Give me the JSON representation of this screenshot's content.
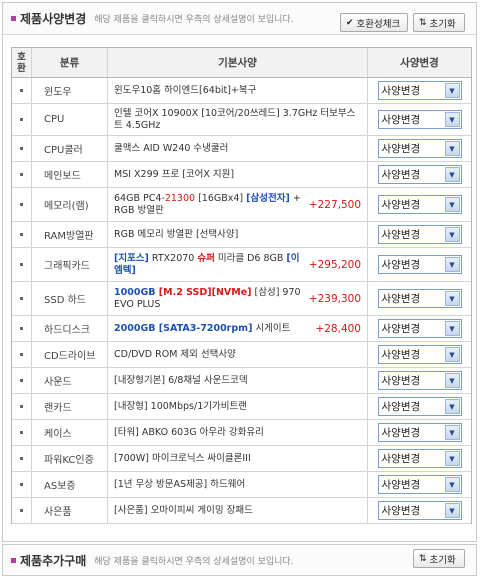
{
  "spec_panel": {
    "title": "제품사양변경",
    "hint": "해당 제품을 클릭하시면 우측의 상세설명이 보입니다.",
    "check_button": "호환성체크",
    "reset_button": "초기화"
  },
  "table": {
    "headers": {
      "no": "호 환",
      "category": "분류",
      "spec": "기본사양",
      "change": "사양변경"
    },
    "select_label": "사양변경",
    "rows": [
      {
        "category": "윈도우",
        "spec": "윈도우10홈 하이엔드[64bit]+복구"
      },
      {
        "category": "CPU",
        "spec": "인텔 코어X 10900X [10코어/20쓰레드] 3.7GHz 터보부스트 4.5GHz"
      },
      {
        "category": "CPU쿨러",
        "spec": "쿨맥스 AID W240 수냉쿨러"
      },
      {
        "category": "메인보드",
        "spec": "MSI X299 프로 [코어X 지원]"
      },
      {
        "category": "메모리(램)",
        "spec_parts": [
          "64GB PC4-",
          "21300",
          " [16GBx4] ",
          "[삼성전자]",
          " + RGB 방열판"
        ],
        "price": "+227,500"
      },
      {
        "category": "RAM방열판",
        "spec": "RGB 메모리 방열판 [선택사양]"
      },
      {
        "category": "그래픽카드",
        "spec_parts": [
          "[지포스]",
          " RTX2070 ",
          "슈퍼",
          " 미라클 D6 8GB ",
          "[이엠텍]"
        ],
        "price": "+295,200"
      },
      {
        "category": "SSD 하드",
        "spec_parts": [
          "1000GB ",
          "[M.2 SSD]",
          "[NVMe]",
          " [삼성] 970 EVO PLUS"
        ],
        "price": "+239,300"
      },
      {
        "category": "하드디스크",
        "spec_parts": [
          "2000GB ",
          "[SATA3-7200rpm]",
          " 시게이트"
        ],
        "price": "+28,400"
      },
      {
        "category": "CD드라이브",
        "spec": "CD/DVD ROM 제외 선택사양"
      },
      {
        "category": "사운드",
        "spec": "[내장형기본] 6/8채널 사운드코덱"
      },
      {
        "category": "랜카드",
        "spec": "[내장형] 100Mbps/1기가비트랜"
      },
      {
        "category": "케이스",
        "spec": "[타워] ABKO 603G 아우라 강화유리"
      },
      {
        "category": "파워KC인증",
        "spec": "[700W] 마이크로닉스 싸이클론III"
      },
      {
        "category": "AS보증",
        "spec": "[1년 무상 방문AS제공] 하드웨어"
      },
      {
        "category": "사은품",
        "spec": "[사은품] 오마이피씨 게이밍 장패드"
      }
    ]
  },
  "extra_panel": {
    "title": "제품추가구매",
    "hint": "해당 제품을 클릭하시면 우측의 상세설명이 보입니다.",
    "reset_button": "초기화"
  },
  "icons": {
    "check": "check-icon",
    "reset": "reset-arrows-icon",
    "dropdown": "chevron-down-icon"
  },
  "colors": {
    "accent": "#b93ba6",
    "price": "#d51818",
    "highlight_blue": "#1e50b0",
    "select_border": "#7a9cd3"
  }
}
